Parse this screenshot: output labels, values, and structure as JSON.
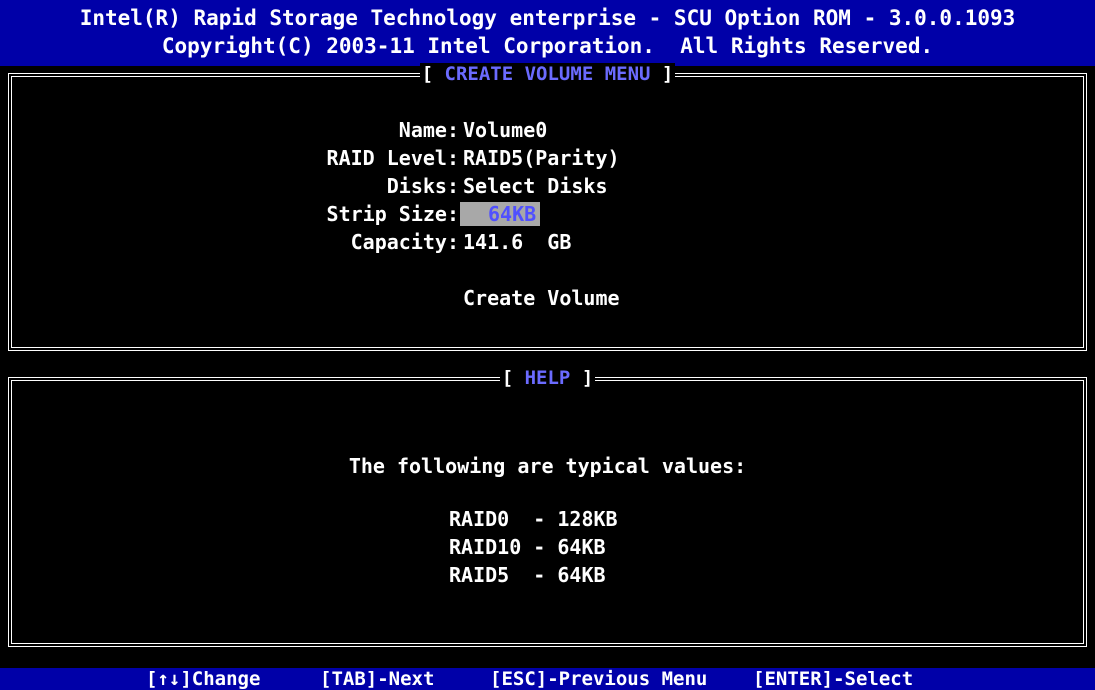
{
  "header": {
    "title": "Intel(R) Rapid Storage Technology enterprise - SCU Option ROM - 3.0.0.1093",
    "copyright": "Copyright(C) 2003-11 Intel Corporation.  All Rights Reserved."
  },
  "create_panel": {
    "bracket_open": "[",
    "title": "CREATE VOLUME MENU",
    "bracket_close": "]",
    "fields": [
      {
        "label": "Name:",
        "value": "Volume0"
      },
      {
        "label": "RAID Level:",
        "value": "RAID5(Parity)"
      },
      {
        "label": "Disks:",
        "value": "Select Disks"
      },
      {
        "label": "Strip Size:",
        "value": "64KB"
      },
      {
        "label": "Capacity:",
        "value": "141.6  GB"
      }
    ],
    "action": "Create Volume"
  },
  "help_panel": {
    "bracket_open": "[",
    "title": "HELP",
    "bracket_close": "]",
    "heading": "The following are typical values:",
    "values": [
      "RAID0  - 128KB",
      "RAID10 - 64KB",
      "RAID5  - 64KB"
    ]
  },
  "footer": {
    "items": [
      "[↑↓]Change",
      "[TAB]-Next",
      "[ESC]-Previous Menu",
      "[ENTER]-Select"
    ]
  },
  "colors": {
    "header_bg": "#0000a8",
    "title_accent": "#6b6bff",
    "selected_bg": "#a8a8a8",
    "selected_fg": "#5050ff"
  }
}
